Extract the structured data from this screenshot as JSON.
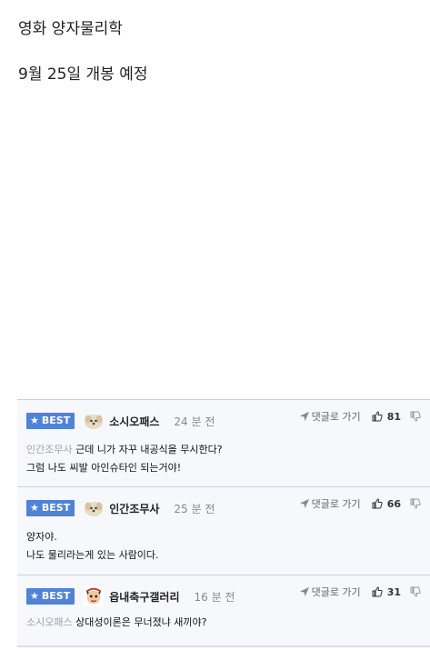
{
  "post": {
    "line1": "영화 양자물리학",
    "line2": "9월 25일 개봉 예정"
  },
  "comments": [
    {
      "badge": "BEST",
      "nick": "소시오패스",
      "time": "24 분 전",
      "reply_label": "댓글로 가기",
      "likes": "81",
      "mention": "인간조무사",
      "text1": "근데 니가 자꾸 내공식을 무시한다?",
      "text2": "그럼 나도 씨발 아인슈타인 되는거야!"
    },
    {
      "badge": "BEST",
      "nick": "인간조무사",
      "time": "25 분 전",
      "reply_label": "댓글로 가기",
      "likes": "66",
      "text1": "양자야.",
      "text2": "나도 물리라는게 있는 사람이다."
    },
    {
      "badge": "BEST",
      "nick": "읍내축구갤러리",
      "time": "16 분 전",
      "reply_label": "댓글로 가기",
      "likes": "31",
      "mention": "소시오패스",
      "text1": "상대성이론은 무너졌냐 새끼야?"
    }
  ],
  "colors": {
    "badge": "#4f83d8",
    "mention": "#9aa3b5",
    "comment_bg": "#f7f8fb"
  }
}
